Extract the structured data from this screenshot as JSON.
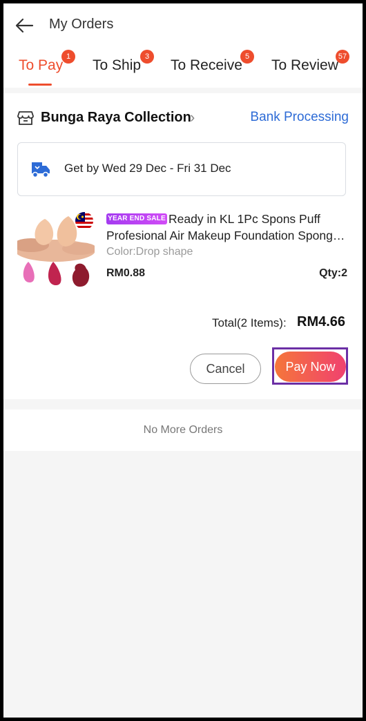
{
  "header": {
    "title": "My Orders"
  },
  "tabs": [
    {
      "label": "To Pay",
      "badge": "1"
    },
    {
      "label": "To Ship",
      "badge": "3"
    },
    {
      "label": "To Receive",
      "badge": "5"
    },
    {
      "label": "To Review",
      "badge": "57"
    }
  ],
  "order": {
    "shop_name": "Bunga Raya Collection",
    "status": "Bank Processing",
    "delivery": "Get by Wed 29 Dec - Fri 31 Dec",
    "product": {
      "promo_tag": "YEAR END SALE",
      "name_line1": "Ready in KL 1Pc Spons Puff",
      "name_line2": "Profesional Air Makeup Foundation Sponge Blender",
      "variant": "Color:Drop shape",
      "price": "RM0.88",
      "qty": "Qty:2"
    },
    "total_label": "Total(2 Items):",
    "total_value": "RM4.66",
    "cancel_label": "Cancel",
    "pay_label": "Pay Now"
  },
  "footer": {
    "no_more": "No More Orders"
  },
  "colors": {
    "accent": "#ee4d2d",
    "status": "#2d6bd6",
    "highlight": "#6b2fa5"
  }
}
